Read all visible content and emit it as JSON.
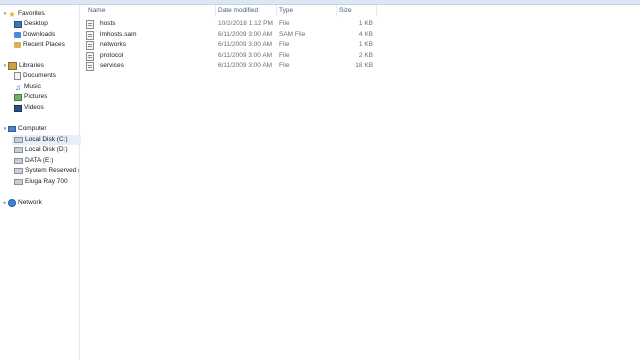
{
  "nav": {
    "favorites": {
      "label": "Favorites",
      "items": [
        {
          "label": "Desktop"
        },
        {
          "label": "Downloads"
        },
        {
          "label": "Recent Places"
        }
      ]
    },
    "libraries": {
      "label": "Libraries",
      "items": [
        {
          "label": "Documents"
        },
        {
          "label": "Music"
        },
        {
          "label": "Pictures"
        },
        {
          "label": "Videos"
        }
      ]
    },
    "computer": {
      "label": "Computer",
      "items": [
        {
          "label": "Local Disk (C:)",
          "selected": true
        },
        {
          "label": "Local Disk (D:)"
        },
        {
          "label": "DATA (E:)"
        },
        {
          "label": "System Reserved (G:)"
        },
        {
          "label": "Eluga Ray 700"
        }
      ]
    },
    "network": {
      "label": "Network"
    }
  },
  "columns": {
    "name": "Name",
    "date": "Date modified",
    "type": "Type",
    "size": "Size"
  },
  "files": [
    {
      "name": "hosts",
      "date": "10/2/2018 1:12 PM",
      "type": "File",
      "size": "1 KB"
    },
    {
      "name": "lmhosts.sam",
      "date": "6/11/2009 3:00 AM",
      "type": "SAM File",
      "size": "4 KB"
    },
    {
      "name": "networks",
      "date": "6/11/2009 3:00 AM",
      "type": "File",
      "size": "1 KB"
    },
    {
      "name": "protocol",
      "date": "6/11/2009 3:00 AM",
      "type": "File",
      "size": "2 KB"
    },
    {
      "name": "services",
      "date": "6/11/2009 3:00 AM",
      "type": "File",
      "size": "18 KB"
    }
  ],
  "colors": {
    "selection": "#e5eef9",
    "header_text": "#4c607a",
    "toolbar": "#dbe7f5"
  }
}
